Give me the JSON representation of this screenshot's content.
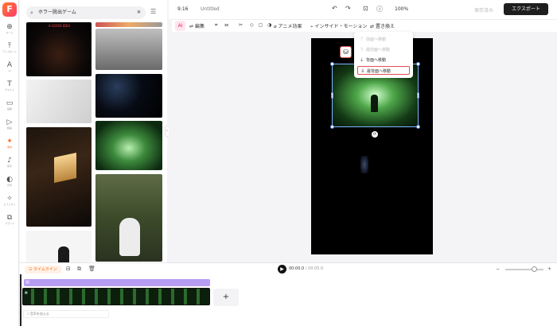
{
  "app": {
    "logo": "F",
    "aspect_ratio": "9:16",
    "title": "Untitled",
    "zoom": "100%",
    "save_label": "保存済み",
    "export_label": "エクスポート"
  },
  "sidebar": {
    "items": [
      {
        "icon": "⊕",
        "label": "ホーム"
      },
      {
        "icon": "⤒",
        "label": "アップロード"
      },
      {
        "icon": "A",
        "label": "AI"
      },
      {
        "icon": "T",
        "label": "テキスト"
      },
      {
        "icon": "▭",
        "label": "画像"
      },
      {
        "icon": "▷",
        "label": "動画"
      },
      {
        "icon": "✦",
        "label": "素材"
      },
      {
        "icon": "♪",
        "label": "音声"
      },
      {
        "icon": "◐",
        "label": "背景"
      },
      {
        "icon": "✧",
        "label": "エフェクト"
      },
      {
        "icon": "⧉",
        "label": "ブランド"
      }
    ],
    "active_index": 6
  },
  "search": {
    "value": "ホラー脱出ゲーム",
    "thumb_caption": "A GOOD IDEA"
  },
  "toolbar": {
    "ai": "AI",
    "edit": "編集",
    "animation": "アニメ効果",
    "inside_motion": "インサイド・モーション",
    "replace": "置き換え"
  },
  "context_menu": {
    "items": [
      {
        "label": "前面へ移動",
        "disabled": true
      },
      {
        "label": "最前面へ移動",
        "disabled": true
      },
      {
        "label": "背面へ移動",
        "disabled": false
      },
      {
        "label": "最背面へ移動",
        "disabled": false,
        "highlighted": true
      }
    ]
  },
  "timeline": {
    "tab": "タイムライン",
    "time_current": "00:00.0",
    "time_total": "/ 00:05.0",
    "audio_placeholder": "音声を加える",
    "add_label": "+"
  },
  "colors": {
    "accent": "#ff6a1a",
    "export_bg": "#1e1e1e",
    "highlight": "#e25050",
    "track_purple": "#b79cf3"
  }
}
